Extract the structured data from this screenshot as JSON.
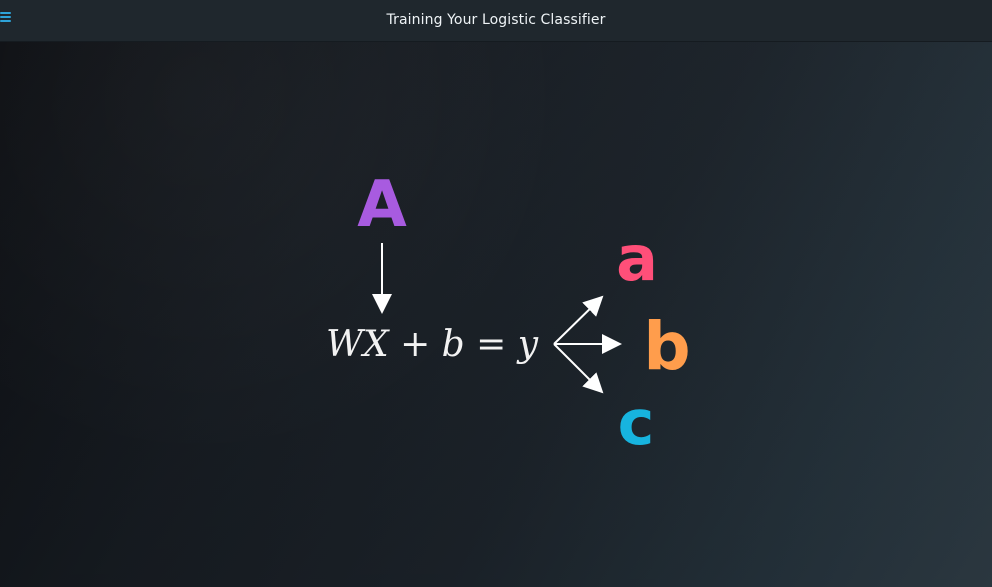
{
  "header": {
    "menu_icon": "menu-icon",
    "title": "Training Your Logistic Classifier"
  },
  "lesson_visual": {
    "input_label": "A",
    "equation": "WX + b = y",
    "output_labels": [
      "a",
      "b",
      "c"
    ],
    "colors": {
      "A": "#a85be0",
      "a": "#ff4f79",
      "b": "#ff9d4c",
      "c": "#17b4df",
      "arrow": "#ffffff",
      "equation": "#f2f2f2",
      "menu": "#2ea3d8"
    }
  }
}
